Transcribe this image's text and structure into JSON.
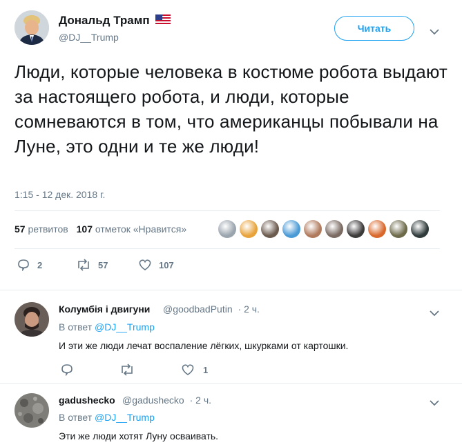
{
  "tweet": {
    "author_name": "Дональд Трамп",
    "author_flag": "🇺🇸",
    "author_handle": "@DJ__Trump",
    "follow_label": "Читать",
    "text": "Люди, которые человека в костюме робота выдают за настоящего робота, и люди, которые сомневаются в том, что американцы побывали на Луне, это одни и те же люди!",
    "timestamp": "1:15 - 12 дек. 2018 г.",
    "retweets_count": "57",
    "retweets_label": "ретвитов",
    "likes_count": "107",
    "likes_label": "отметок «Нравится»",
    "replies_count": "2",
    "retweet_action_count": "57",
    "like_action_count": "107",
    "favoriter_avatar_colors": [
      "#9aa4ad",
      "#e8a33c",
      "#6b5a4e",
      "#4a9ad6",
      "#b07a5c",
      "#7a6a62",
      "#3d3a3a",
      "#d9682c",
      "#6d6a4a",
      "#2f3a3a"
    ]
  },
  "replies": [
    {
      "name": "Колумбія і двигуни",
      "handle": "@goodbadPutin",
      "time": "· 2 ч.",
      "reply_prefix": "В ответ",
      "reply_to": "@DJ__Trump",
      "text": "И эти же люди лечат воспаление лёгких, шкурками от картошки.",
      "reply_count": "",
      "retweet_count": "",
      "like_count": "1"
    },
    {
      "name": "gadushecko",
      "handle": "@gadushecko",
      "time": "· 2 ч.",
      "reply_prefix": "В ответ",
      "reply_to": "@DJ__Trump",
      "text": "Эти же люди хотят Луну осваивать."
    }
  ],
  "colors": {
    "accent": "#1da1f2",
    "secondary_text": "#657786",
    "primary_text": "#14171a",
    "divider": "#e6ecf0"
  }
}
